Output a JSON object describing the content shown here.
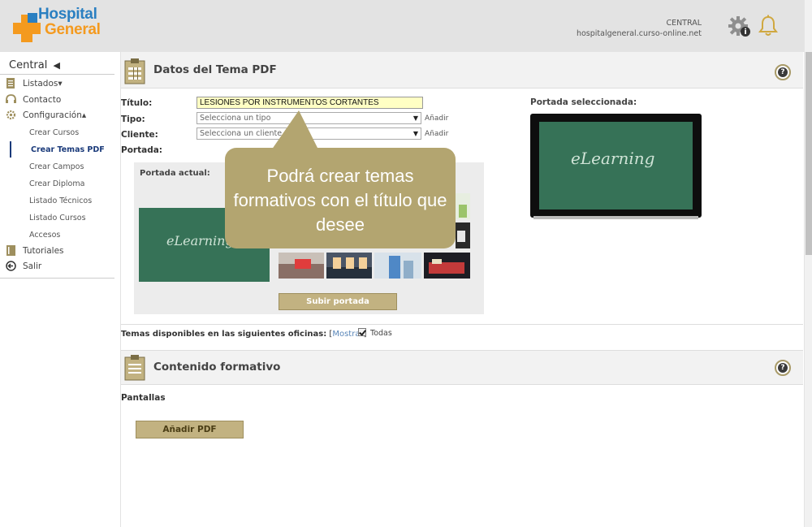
{
  "header": {
    "logo_line1": "Hospital",
    "logo_line2": "General",
    "org": "CENTRAL",
    "domain": "hospitalgeneral.curso-online.net"
  },
  "sidebar": {
    "title": "Central",
    "items": [
      {
        "label": "Listados▾",
        "icon": "list-icon"
      },
      {
        "label": "Contacto",
        "icon": "headset-icon"
      },
      {
        "label": "Configuración▴",
        "icon": "gear-icon"
      },
      {
        "label": "Tutoriales",
        "icon": "book-icon"
      },
      {
        "label": "Salir",
        "icon": "exit-icon"
      }
    ],
    "sub_items": [
      "Crear Cursos",
      "Crear Temas PDF",
      "Crear Campos",
      "Crear Diploma",
      "Listado Técnicos",
      "Listado Cursos",
      "Accesos"
    ]
  },
  "main": {
    "section1_title": "Datos del Tema PDF",
    "labels": {
      "titulo": "Título:",
      "tipo": "Tipo:",
      "cliente": "Cliente:",
      "portada": "Portada:"
    },
    "titulo_value": "LESIONES POR INSTRUMENTOS CORTANTES",
    "tipo_placeholder": "Selecciona un tipo",
    "cliente_placeholder": "Selecciona un cliente",
    "add_label": "Añadir",
    "portada_actual": "Portada actual:",
    "upload_button": "Subir portada",
    "portada_seleccionada": "Portada seleccionada:",
    "image_text": "eLearning",
    "oficinas_text": "Temas disponibles en las siguientes oficinas:",
    "mostrar_link": "Mostrar",
    "todas_label": "Todas",
    "section2_title": "Contenido formativo",
    "pantallas": "Pantallas",
    "add_pdf": "Añadir PDF"
  },
  "callout": {
    "text": "Podrá crear temas formativos con el título que desee"
  },
  "colors": {
    "accent_gold": "#c2b281",
    "callout": "#b3a570",
    "header_bg": "#e3e3e3",
    "logo_blue": "#2a7fc1",
    "logo_orange": "#f49a1f",
    "title_field_bg": "#ffffc4"
  }
}
